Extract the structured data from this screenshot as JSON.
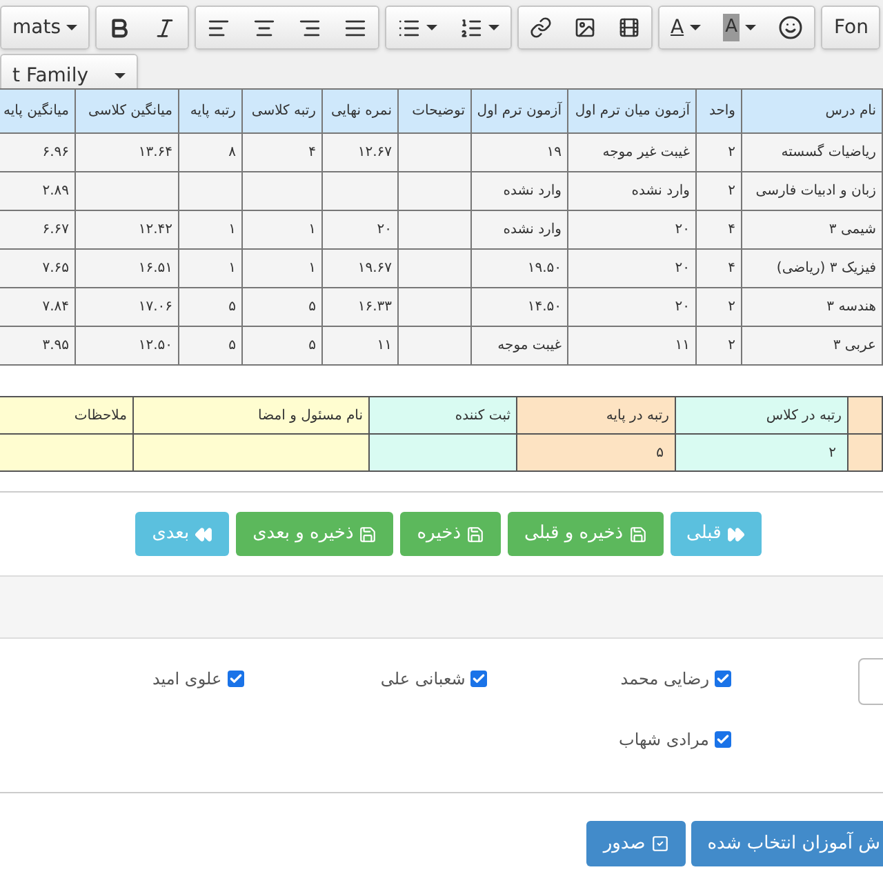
{
  "toolbar": {
    "formats": "mats",
    "font_size": "Fon",
    "font_family": "t Family",
    "text_color": "A",
    "background_color": "A"
  },
  "grades_table": {
    "columns": [
      "نام درس",
      "واحد",
      "آزمون میان ترم اول",
      "آزمون ترم اول",
      "توضیحات",
      "نمره نهایی",
      "رتبه کلاسی",
      "رتبه پایه",
      "میانگین کلاسی",
      "میانگین پایه"
    ],
    "rows": [
      [
        "ریاضیات گسسته",
        "۲",
        "غیبت غیر موجه",
        "۱۹",
        null,
        "۱۲.۶۷",
        "۴",
        "۸",
        "۱۳.۶۴",
        "۶.۹۶"
      ],
      [
        "زبان و ادبیات فارسی",
        "۲",
        "وارد نشده",
        "وارد نشده",
        null,
        null,
        null,
        null,
        null,
        "۲.۸۹"
      ],
      [
        "شیمی ۳",
        "۴",
        "۲۰",
        "وارد نشده",
        null,
        "۲۰",
        "۱",
        "۱",
        "۱۲.۴۲",
        "۶.۶۷"
      ],
      [
        "فیزیک ۳ (ریاضی)",
        "۴",
        "۲۰",
        "۱۹.۵۰",
        null,
        "۱۹.۶۷",
        "۱",
        "۱",
        "۱۶.۵۱",
        "۷.۶۵"
      ],
      [
        "هندسه ۳",
        "۲",
        "۲۰",
        "۱۴.۵۰",
        null,
        "۱۶.۳۳",
        "۵",
        "۵",
        "۱۷.۰۶",
        "۷.۸۴"
      ],
      [
        "عربی ۳",
        "۲",
        "۱۱",
        "غیبت موجه",
        null,
        "۱۱",
        "۵",
        "۵",
        "۱۲.۵۰",
        "۳.۹۵"
      ]
    ]
  },
  "summary_table": {
    "columns": [
      {
        "label": "رتبه در کلاس",
        "color": "#d9fbf2",
        "value": "۲"
      },
      {
        "label": "رتبه در پایه",
        "color": "#fde3c2",
        "value": "۵"
      },
      {
        "label": "ثبت کننده",
        "color": "#d9fbf2"
      },
      {
        "label": "نام مسئول و امضا",
        "color": "#fffdd0"
      },
      {
        "label": "ملاحظات",
        "color": "#fffdd0"
      }
    ]
  },
  "nav_buttons": [
    {
      "label": "قبلی",
      "kind": "prev"
    },
    {
      "label": "ذخیره و قبلی",
      "kind": "save"
    },
    {
      "label": "ذخیره",
      "kind": "save"
    },
    {
      "label": "ذخیره و بعدی",
      "kind": "save"
    },
    {
      "label": "بعدی",
      "kind": "next"
    }
  ],
  "students": [
    {
      "name": "رضایی محمد",
      "checked": true
    },
    {
      "name": "شعبانی علی",
      "checked": true
    },
    {
      "name": "علوی امید",
      "checked": true
    },
    {
      "name": "مرادی شهاب",
      "checked": true
    }
  ],
  "actions": [
    {
      "label": "ش آموزان انتخاب شده",
      "kind": "plain"
    },
    {
      "label": "صدور",
      "kind": "issue"
    }
  ]
}
